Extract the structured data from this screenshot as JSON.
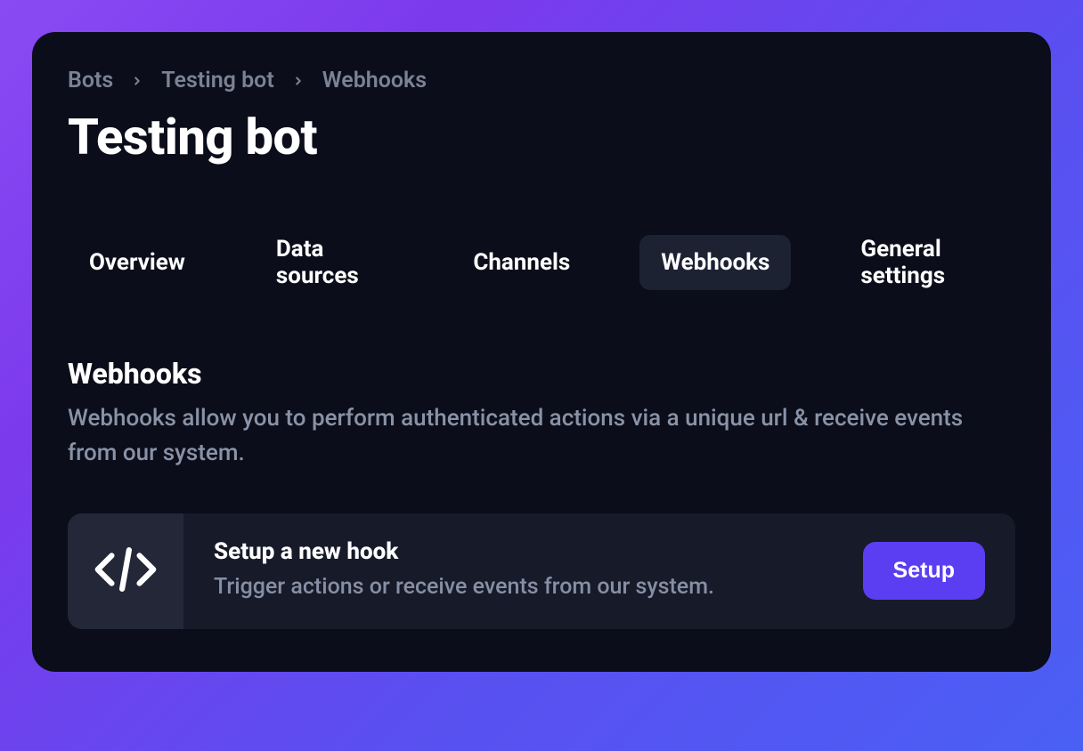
{
  "breadcrumb": {
    "items": [
      "Bots",
      "Testing bot",
      "Webhooks"
    ]
  },
  "page_title": "Testing bot",
  "tabs": {
    "items": [
      {
        "label": "Overview",
        "active": false
      },
      {
        "label": "Data sources",
        "active": false
      },
      {
        "label": "Channels",
        "active": false
      },
      {
        "label": "Webhooks",
        "active": true
      },
      {
        "label": "General settings",
        "active": false
      }
    ]
  },
  "section": {
    "title": "Webhooks",
    "description": "Webhooks allow you to perform authenticated actions via a unique url & receive events from our system."
  },
  "card": {
    "icon": "code-icon",
    "title": "Setup a new hook",
    "description": "Trigger actions or receive events from our system.",
    "button_label": "Setup"
  },
  "colors": {
    "accent": "#5b3ef2",
    "panel_bg": "#0b0d1a",
    "card_bg": "#161a29",
    "iconbox_bg": "#232738",
    "muted_text": "#8a92a6"
  }
}
